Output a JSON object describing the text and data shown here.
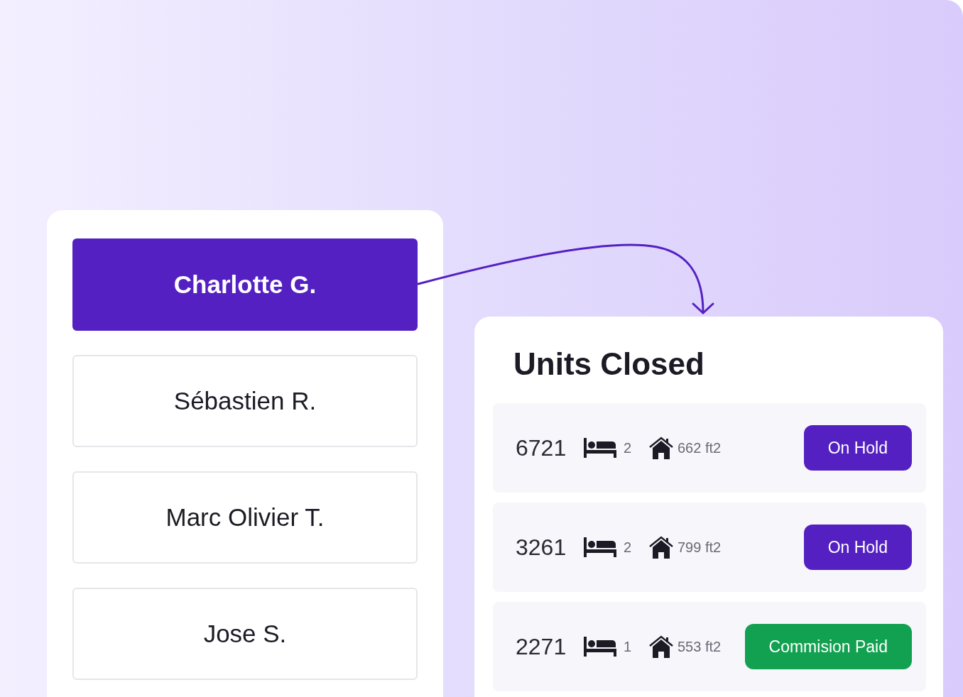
{
  "people": [
    {
      "name": "Charlotte G.",
      "selected": true
    },
    {
      "name": "Sébastien R.",
      "selected": false
    },
    {
      "name": "Marc Olivier T.",
      "selected": false
    },
    {
      "name": "Jose S.",
      "selected": false
    }
  ],
  "units_card": {
    "title": "Units Closed",
    "units": [
      {
        "number": "6721",
        "beds": "2",
        "area": "662 ft2",
        "status": "On Hold",
        "color": "#5420c2"
      },
      {
        "number": "3261",
        "beds": "2",
        "area": "799 ft2",
        "status": "On Hold",
        "color": "#5420c2"
      },
      {
        "number": "2271",
        "beds": "1",
        "area": "553 ft2",
        "status": "Commision Paid",
        "color": "#12a150"
      }
    ]
  }
}
